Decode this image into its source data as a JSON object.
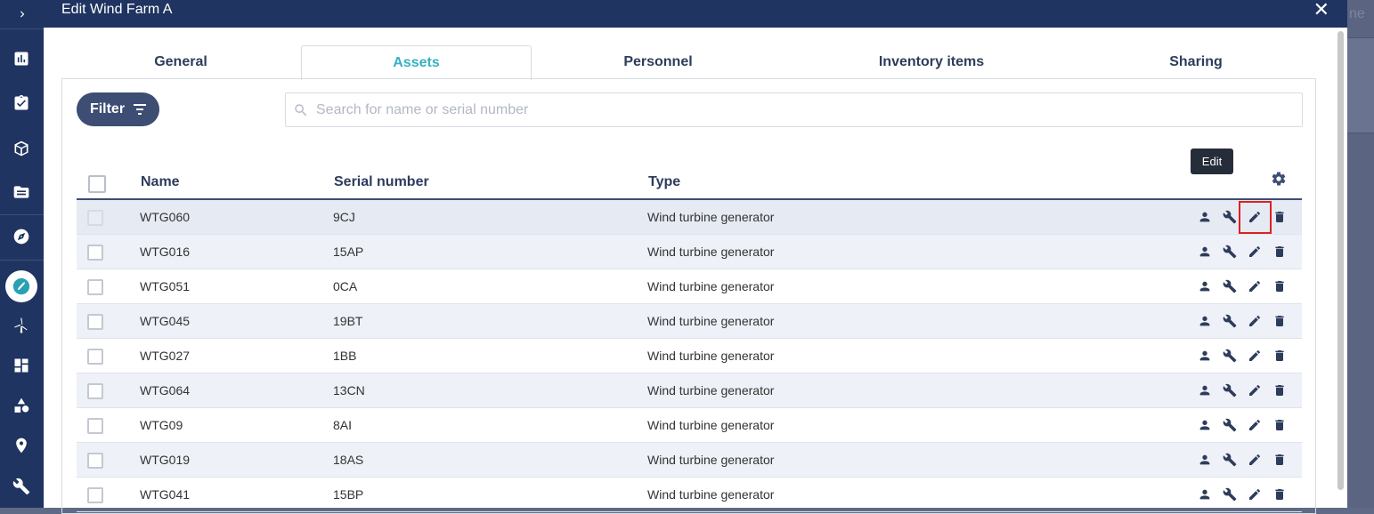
{
  "sidebar": {
    "items": [
      {
        "icon": "chevron-right-icon"
      },
      {
        "icon": "bar-chart-icon"
      },
      {
        "icon": "clipboard-check-icon"
      },
      {
        "icon": "box-icon"
      },
      {
        "icon": "folder-icon"
      },
      {
        "icon": "compass-icon"
      },
      {
        "icon": "compass-active-icon"
      },
      {
        "icon": "wind-turbine-icon"
      },
      {
        "icon": "dashboard-icon"
      },
      {
        "icon": "shapes-icon"
      },
      {
        "icon": "location-pin-icon"
      },
      {
        "icon": "wrench-icon"
      }
    ]
  },
  "background": {
    "ghost_text": "ne"
  },
  "modal": {
    "title": "Edit Wind Farm A",
    "close_symbol": "✕"
  },
  "tabs": [
    {
      "label": "General",
      "active": false
    },
    {
      "label": "Assets",
      "active": true
    },
    {
      "label": "Personnel",
      "active": false
    },
    {
      "label": "Inventory items",
      "active": false
    },
    {
      "label": "Sharing",
      "active": false
    }
  ],
  "filter": {
    "label": "Filter"
  },
  "search": {
    "placeholder": "Search for name or serial number",
    "value": ""
  },
  "table": {
    "columns": [
      "Name",
      "Serial number",
      "Type"
    ],
    "rows": [
      {
        "name": "WTG060",
        "serial": "9CJ",
        "type": "Wind turbine generator"
      },
      {
        "name": "WTG016",
        "serial": "15AP",
        "type": "Wind turbine generator"
      },
      {
        "name": "WTG051",
        "serial": "0CA",
        "type": "Wind turbine generator"
      },
      {
        "name": "WTG045",
        "serial": "19BT",
        "type": "Wind turbine generator"
      },
      {
        "name": "WTG027",
        "serial": "1BB",
        "type": "Wind turbine generator"
      },
      {
        "name": "WTG064",
        "serial": "13CN",
        "type": "Wind turbine generator"
      },
      {
        "name": "WTG09",
        "serial": "8AI",
        "type": "Wind turbine generator"
      },
      {
        "name": "WTG019",
        "serial": "18AS",
        "type": "Wind turbine generator"
      },
      {
        "name": "WTG041",
        "serial": "15BP",
        "type": "Wind turbine generator"
      }
    ],
    "row_actions": [
      "person-icon",
      "wrench-icon",
      "pencil-icon",
      "trash-icon"
    ]
  },
  "tooltip": {
    "text": "Edit"
  },
  "colors": {
    "header_bg": "#1f3461",
    "accent": "#35b0c4",
    "filter_bg": "#3d4d73",
    "highlight": "#e02020"
  }
}
